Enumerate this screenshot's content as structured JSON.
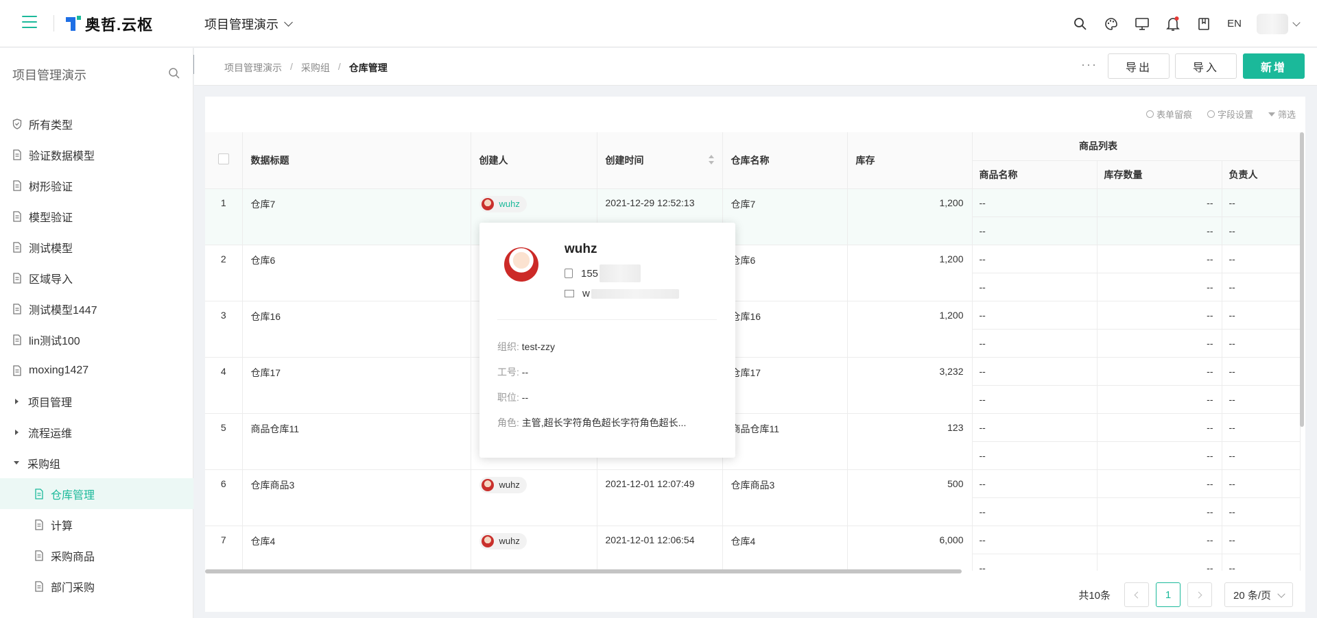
{
  "header": {
    "logo_text": "奥哲.云枢",
    "project_name": "项目管理演示",
    "lang": "EN",
    "icons": [
      "search-icon",
      "palette-icon",
      "monitor-icon",
      "bell-icon",
      "book-icon"
    ]
  },
  "sidebar": {
    "title": "项目管理演示",
    "items": [
      {
        "label": "所有类型",
        "icon": "shield-icon"
      },
      {
        "label": "验证数据模型",
        "icon": "doc-icon"
      },
      {
        "label": "树形验证",
        "icon": "doc-icon"
      },
      {
        "label": "模型验证",
        "icon": "doc-icon"
      },
      {
        "label": "测试模型",
        "icon": "doc-icon"
      },
      {
        "label": "区域导入",
        "icon": "doc-icon"
      },
      {
        "label": "测试模型1447",
        "icon": "doc-icon"
      },
      {
        "label": "lin测试100",
        "icon": "doc-icon"
      },
      {
        "label": "moxing1427",
        "icon": "doc-icon"
      },
      {
        "label": "项目管理",
        "icon": "caret-right-icon"
      },
      {
        "label": "流程运维",
        "icon": "caret-right-icon"
      },
      {
        "label": "采购组",
        "icon": "caret-down-icon"
      },
      {
        "label": "仓库管理",
        "icon": "doc-icon"
      },
      {
        "label": "计算",
        "icon": "doc-icon"
      },
      {
        "label": "采购商品",
        "icon": "doc-icon"
      },
      {
        "label": "部门采购",
        "icon": "doc-icon"
      }
    ]
  },
  "breadcrumb": {
    "items": [
      "项目管理演示",
      "采购组",
      "仓库管理"
    ],
    "sep": "/"
  },
  "toolbar": {
    "more": "···",
    "export": "导出",
    "import": "导入",
    "add": "新增"
  },
  "tools": {
    "trace": "表单留痕",
    "fields": "字段设置",
    "filter": "筛选"
  },
  "table": {
    "headers": {
      "title": "数据标题",
      "creator": "创建人",
      "created": "创建时间",
      "warehouse": "仓库名称",
      "stock": "库存",
      "group": "商品列表",
      "goods_name": "商品名称",
      "goods_qty": "库存数量",
      "owner": "负责人"
    },
    "rows": [
      {
        "no": "1",
        "title": "仓库7",
        "creator": "wuhz",
        "created": "2021-12-29 12:52:13",
        "warehouse": "仓库7",
        "stock": "1,200"
      },
      {
        "no": "2",
        "title": "仓库6",
        "creator": "",
        "created": "",
        "warehouse": "仓库6",
        "stock": "1,200"
      },
      {
        "no": "3",
        "title": "仓库16",
        "creator": "",
        "created": "",
        "warehouse": "仓库16",
        "stock": "1,200"
      },
      {
        "no": "4",
        "title": "仓库17",
        "creator": "",
        "created": "",
        "warehouse": "仓库17",
        "stock": "3,232"
      },
      {
        "no": "5",
        "title": "商品仓库11",
        "creator": "",
        "created": "",
        "warehouse": "商品仓库11",
        "stock": "123"
      },
      {
        "no": "6",
        "title": "仓库商品3",
        "creator": "wuhz",
        "created": "2021-12-01 12:07:49",
        "warehouse": "仓库商品3",
        "stock": "500"
      },
      {
        "no": "7",
        "title": "仓库4",
        "creator": "wuhz",
        "created": "2021-12-01 12:06:54",
        "warehouse": "仓库4",
        "stock": "6,000"
      }
    ],
    "empty": "--"
  },
  "pagination": {
    "total": "共10条",
    "page": "1",
    "size": "20 条/页"
  },
  "popover": {
    "name": "wuhz",
    "phone": "155",
    "email": "w",
    "org_label": "组织:",
    "org": "test-zzy",
    "job_no_label": "工号:",
    "job_no": "--",
    "position_label": "职位:",
    "position": "--",
    "role_label": "角色:",
    "role": "主管,超长字符角色超长字符角色超长..."
  }
}
